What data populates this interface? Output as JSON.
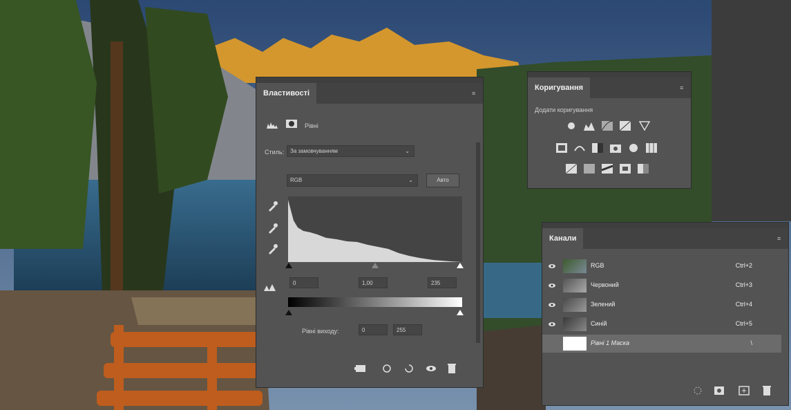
{
  "properties_panel": {
    "tab_title": "Властивості",
    "layer_type": "Рівні",
    "preset_label": "Стиль:",
    "preset_value": "За замовчуванням",
    "channel_value": "RGB",
    "auto_label": "Авто",
    "input_black": "0",
    "input_gamma": "1,00",
    "input_white": "235",
    "output_label": "Рівні виходу:",
    "output_black": "0",
    "output_white": "255"
  },
  "adjustments_panel": {
    "tab_title": "Коригування",
    "subtitle": "Додати коригування"
  },
  "channels_panel": {
    "tab_title": "Канали",
    "rows": [
      {
        "name": "RGB",
        "shortcut": "Ctrl+2"
      },
      {
        "name": "Червоний",
        "shortcut": "Ctrl+3"
      },
      {
        "name": "Зелений",
        "shortcut": "Ctrl+4"
      },
      {
        "name": "Синій",
        "shortcut": "Ctrl+5"
      },
      {
        "name": "Рівні 1 Маска",
        "shortcut": "\\"
      }
    ]
  },
  "icons": [
    "eyedropper-icon",
    "eye-icon",
    "trash-icon",
    "visibility-icon",
    "reset-icon",
    "clip-icon",
    "histogram-icon",
    "mask-icon"
  ]
}
